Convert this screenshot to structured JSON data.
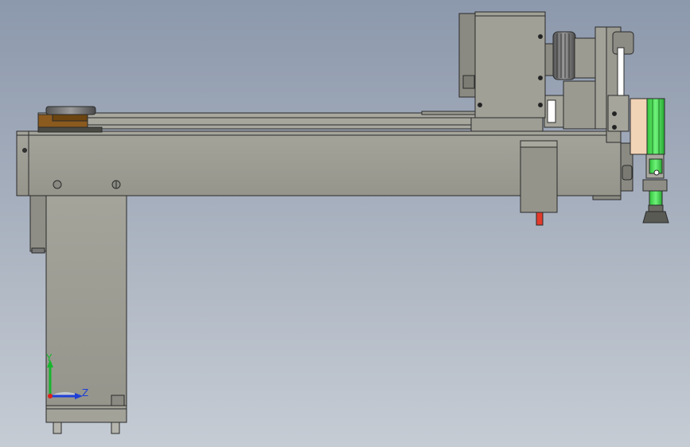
{
  "triad": {
    "x_label": "",
    "y_label": "Y",
    "z_label": "Z",
    "x_color": "#e0201c",
    "y_color": "#17b52e",
    "z_color": "#1f3fd6"
  },
  "model": {
    "body_color": "#9c9c93",
    "edge_color": "#2a2a2a",
    "accent_green": "#3fd84b",
    "accent_bronze": "#8b5a1e",
    "accent_red": "#e23a2a",
    "accent_cream": "#f1d3b6"
  }
}
